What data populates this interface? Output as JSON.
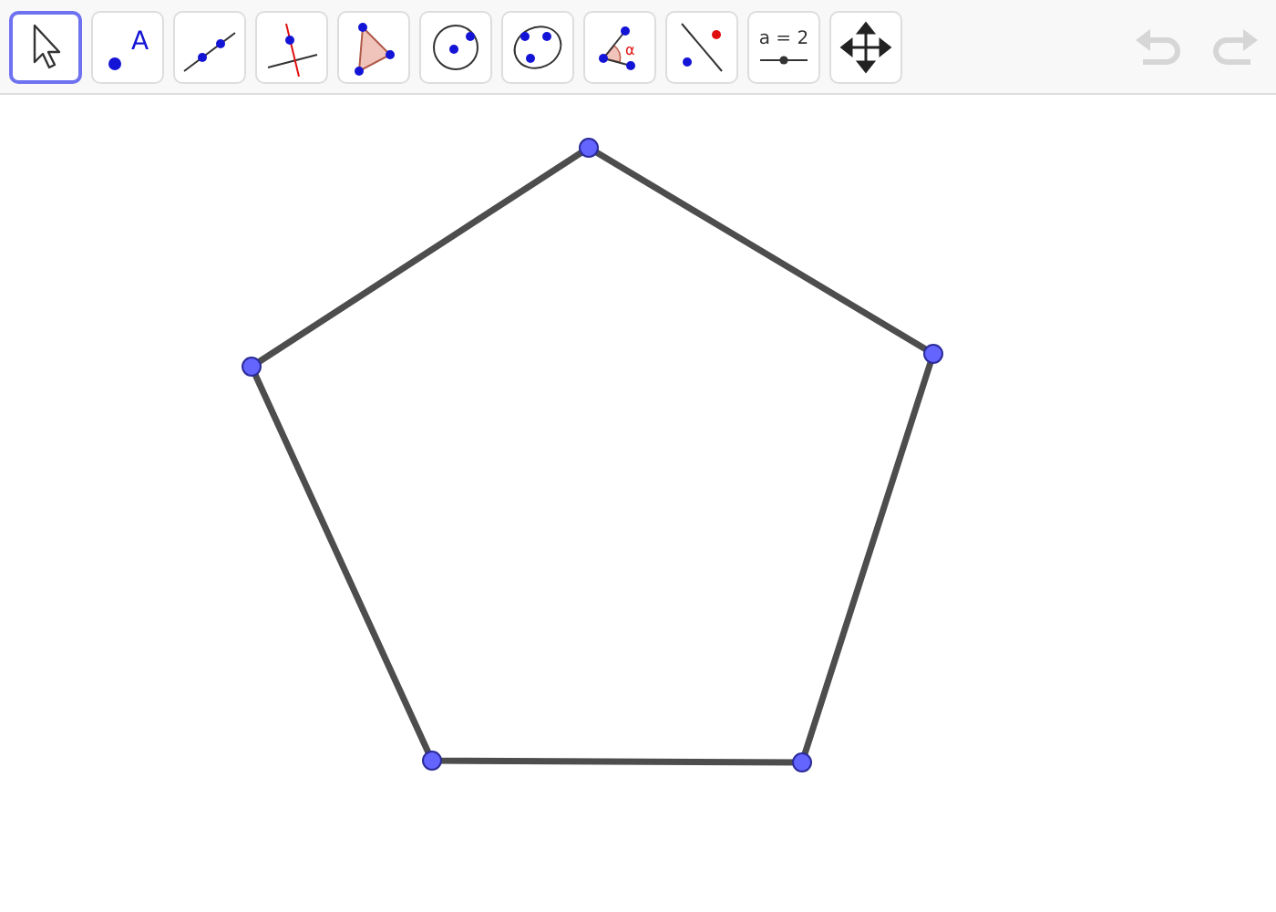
{
  "toolbar": {
    "tools": [
      {
        "kind": "move",
        "selected": true
      },
      {
        "kind": "point",
        "label": "A",
        "selected": false
      },
      {
        "kind": "line",
        "selected": false
      },
      {
        "kind": "perpendicular",
        "selected": false
      },
      {
        "kind": "polygon",
        "selected": false
      },
      {
        "kind": "circle",
        "selected": false
      },
      {
        "kind": "conic",
        "selected": false
      },
      {
        "kind": "angle",
        "label": "α",
        "selected": false
      },
      {
        "kind": "reflect",
        "selected": false
      },
      {
        "kind": "slider",
        "label": "a = 2",
        "selected": false
      },
      {
        "kind": "pan",
        "selected": false
      }
    ],
    "history": [
      {
        "kind": "undo",
        "disabled": true
      },
      {
        "kind": "redo",
        "disabled": true
      }
    ]
  },
  "canvas": {
    "kind": "polygon"
  }
}
